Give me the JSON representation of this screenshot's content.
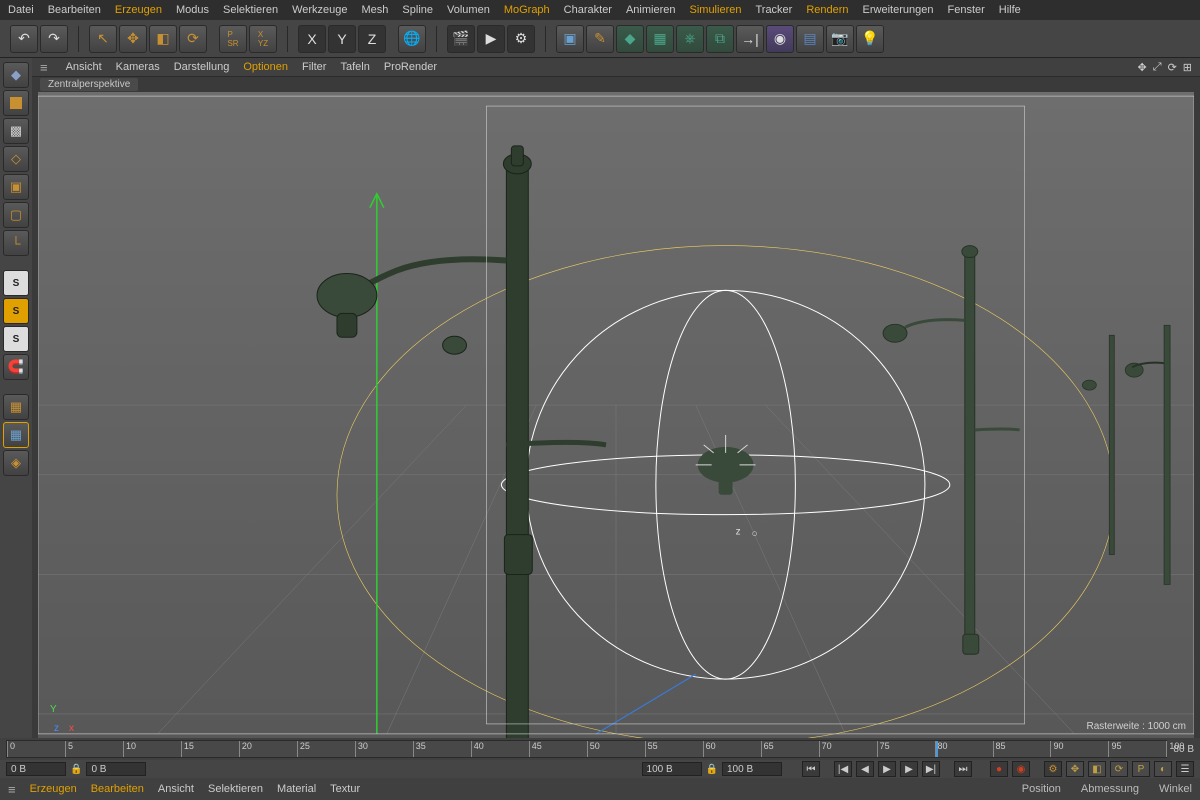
{
  "menubar": {
    "items": [
      {
        "label": "Datei",
        "hl": false
      },
      {
        "label": "Bearbeiten",
        "hl": false
      },
      {
        "label": "Erzeugen",
        "hl": true
      },
      {
        "label": "Modus",
        "hl": false
      },
      {
        "label": "Selektieren",
        "hl": false
      },
      {
        "label": "Werkzeuge",
        "hl": false
      },
      {
        "label": "Mesh",
        "hl": false
      },
      {
        "label": "Spline",
        "hl": false
      },
      {
        "label": "Volumen",
        "hl": false
      },
      {
        "label": "MoGraph",
        "hl": true
      },
      {
        "label": "Charakter",
        "hl": false
      },
      {
        "label": "Animieren",
        "hl": false
      },
      {
        "label": "Simulieren",
        "hl": true
      },
      {
        "label": "Tracker",
        "hl": false
      },
      {
        "label": "Rendern",
        "hl": true
      },
      {
        "label": "Erweiterungen",
        "hl": false
      },
      {
        "label": "Fenster",
        "hl": false
      },
      {
        "label": "Hilfe",
        "hl": false
      }
    ]
  },
  "viewport_menu": {
    "items": [
      {
        "label": "Ansicht",
        "hl": false
      },
      {
        "label": "Kameras",
        "hl": false
      },
      {
        "label": "Darstellung",
        "hl": false
      },
      {
        "label": "Optionen",
        "hl": true
      },
      {
        "label": "Filter",
        "hl": false
      },
      {
        "label": "Tafeln",
        "hl": false
      },
      {
        "label": "ProRender",
        "hl": false
      }
    ]
  },
  "viewport": {
    "perspective_label": "Zentralperspektive",
    "grid_label": "Rasterweite : 1000 cm",
    "axis": {
      "y": "Y",
      "x": "x",
      "z": "z"
    }
  },
  "timeline": {
    "ticks": [
      "0",
      "5",
      "10",
      "15",
      "20",
      "25",
      "30",
      "35",
      "40",
      "45",
      "50",
      "55",
      "60",
      "65",
      "70",
      "75",
      "80",
      "85",
      "90",
      "95",
      "100"
    ],
    "current_frame": "80",
    "end_label": "80 B",
    "handle_pct": 80
  },
  "transport": {
    "start_field": "0 B",
    "start_field2": "0 B",
    "end_field": "100 B",
    "end_field2": "100 B"
  },
  "bottombar": {
    "items": [
      {
        "label": "Erzeugen",
        "hl": true
      },
      {
        "label": "Bearbeiten",
        "hl": true
      },
      {
        "label": "Ansicht",
        "hl": false
      },
      {
        "label": "Selektieren",
        "hl": false
      },
      {
        "label": "Material",
        "hl": false
      },
      {
        "label": "Textur",
        "hl": false
      }
    ],
    "right": [
      "Position",
      "Abmessung",
      "Winkel"
    ]
  },
  "left_tools": {
    "snap_labels": [
      "S",
      "S",
      "S"
    ]
  },
  "toolbar": {
    "axis_labels": [
      "X",
      "Y",
      "Z"
    ]
  }
}
